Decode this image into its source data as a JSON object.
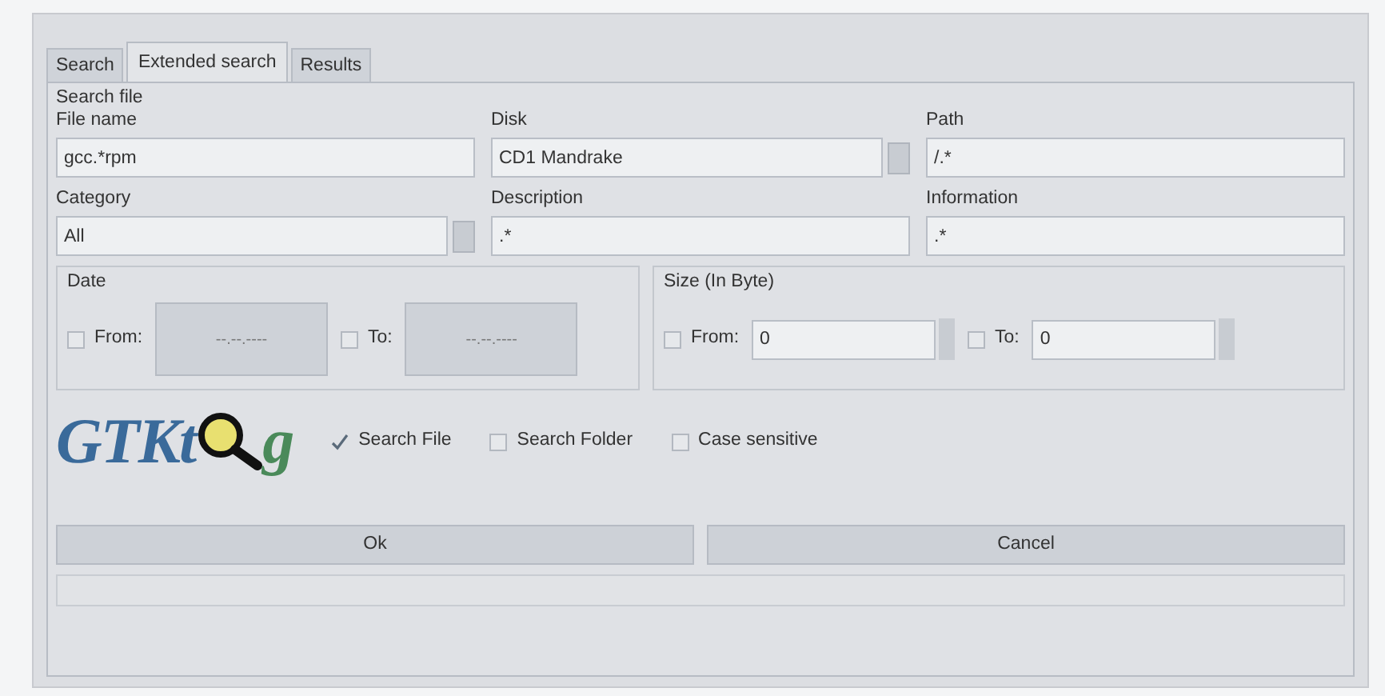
{
  "tabs": [
    {
      "label": "Search",
      "selected": false
    },
    {
      "label": "Extended search",
      "selected": true
    },
    {
      "label": "Results",
      "selected": false
    }
  ],
  "group_title": "Search file",
  "field_rows": [
    [
      {
        "label": "File name",
        "value": "gcc.*rpm",
        "kind": "text"
      },
      {
        "label": "Disk",
        "value": "CD1 Mandrake",
        "kind": "combo"
      },
      {
        "label": "Path",
        "value": "/.*",
        "kind": "text"
      }
    ],
    [
      {
        "label": "Category",
        "value": "All",
        "kind": "combo"
      },
      {
        "label": "Description",
        "value": ".*",
        "kind": "text"
      },
      {
        "label": "Information",
        "value": ".*",
        "kind": "text"
      }
    ]
  ],
  "ranges": [
    {
      "title": "Date",
      "kind": "date",
      "from": {
        "label": "From:",
        "checked": false,
        "value": "--.--.----"
      },
      "to": {
        "label": "To:",
        "checked": false,
        "value": "--.--.----"
      }
    },
    {
      "title": "Size (In Byte)",
      "kind": "spin",
      "from": {
        "label": "From:",
        "checked": false,
        "value": "0"
      },
      "to": {
        "label": "To:",
        "checked": false,
        "value": "0"
      }
    }
  ],
  "logo": {
    "before": "GTKt",
    "after": "g"
  },
  "options": [
    {
      "label": "Search File",
      "checked": true
    },
    {
      "label": "Search Folder",
      "checked": false
    },
    {
      "label": "Case sensitive",
      "checked": false
    }
  ],
  "buttons": [
    "Ok",
    "Cancel"
  ]
}
